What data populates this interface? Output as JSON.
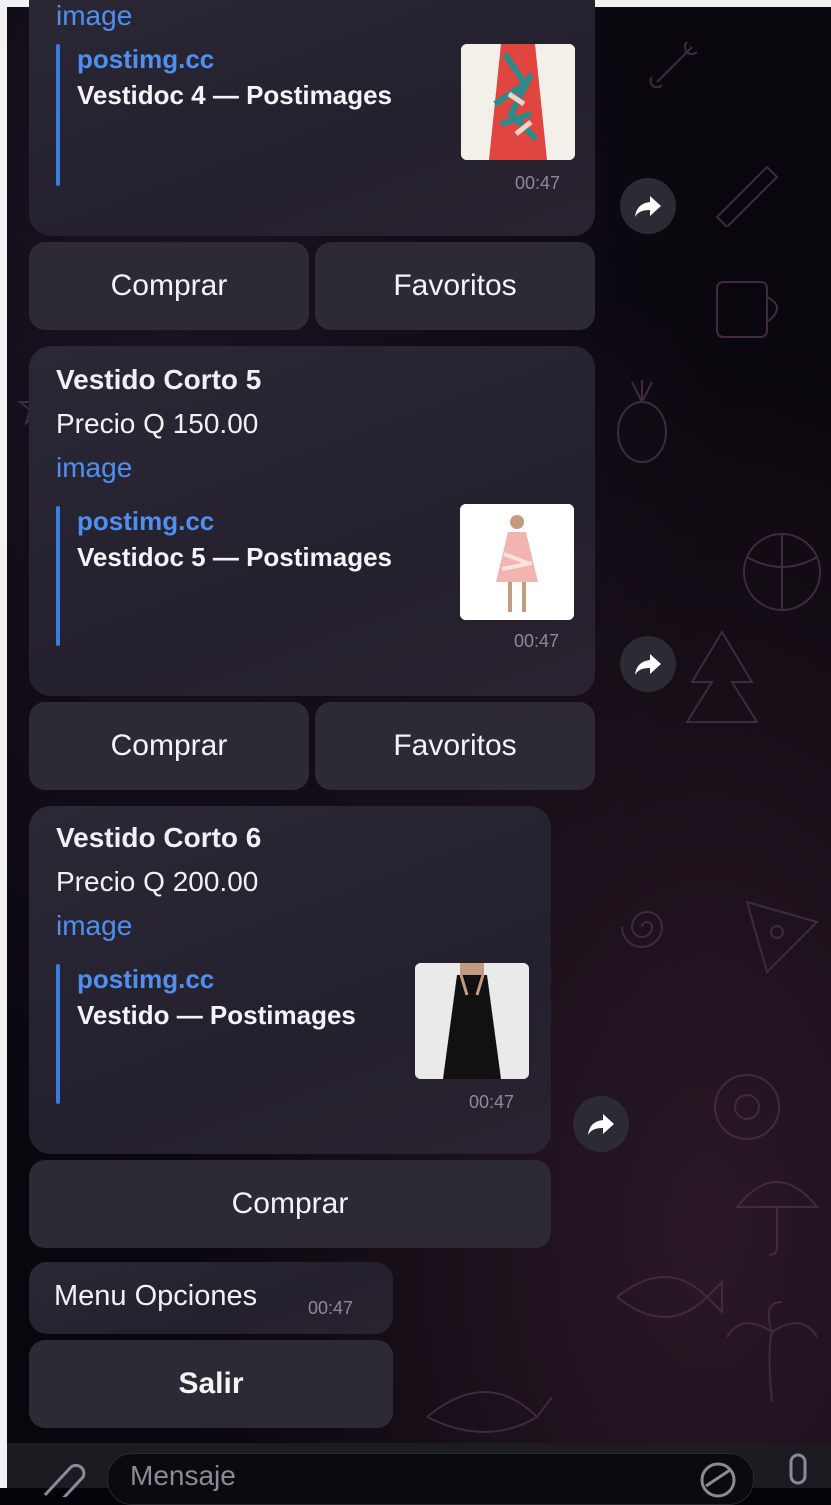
{
  "messages": [
    {
      "title": "",
      "top_fragment": "image",
      "link_site": "postimg.cc",
      "link_title": "Vestidoc 4 — Postimages",
      "time": "00:47",
      "buttons": [
        "Comprar",
        "Favoritos"
      ],
      "thumb_colors": [
        "#e0453f",
        "#2a8c8a",
        "#f4d3c6"
      ]
    },
    {
      "title": "Vestido Corto 5",
      "price": "Precio Q 150.00",
      "image_link": "image",
      "link_site": "postimg.cc",
      "link_title": "Vestidoc 5 — Postimages",
      "time": "00:47",
      "buttons": [
        "Comprar",
        "Favoritos"
      ],
      "thumb_colors": [
        "#f1b4ae",
        "#f9e3df"
      ]
    },
    {
      "title": "Vestido Corto 6",
      "price": "Precio Q 200.00",
      "image_link": "image",
      "link_site": "postimg.cc",
      "link_title": "Vestido — Postimages",
      "time": "00:47",
      "buttons": [
        "Comprar"
      ],
      "thumb_colors": [
        "#111111",
        "#e8e8e8"
      ]
    }
  ],
  "menu": {
    "text": "Menu Opciones",
    "time": "00:47",
    "button": "Salir"
  },
  "composer": {
    "placeholder": "Mensaje"
  },
  "icons": {
    "share": "share-arrow-icon",
    "attach": "paperclip-icon",
    "sticker": "sticker-icon",
    "mic": "microphone-icon"
  },
  "colors": {
    "link": "#4f8ff0",
    "bubble": "#2b2836",
    "keyboard_button": "#2d2a35"
  }
}
